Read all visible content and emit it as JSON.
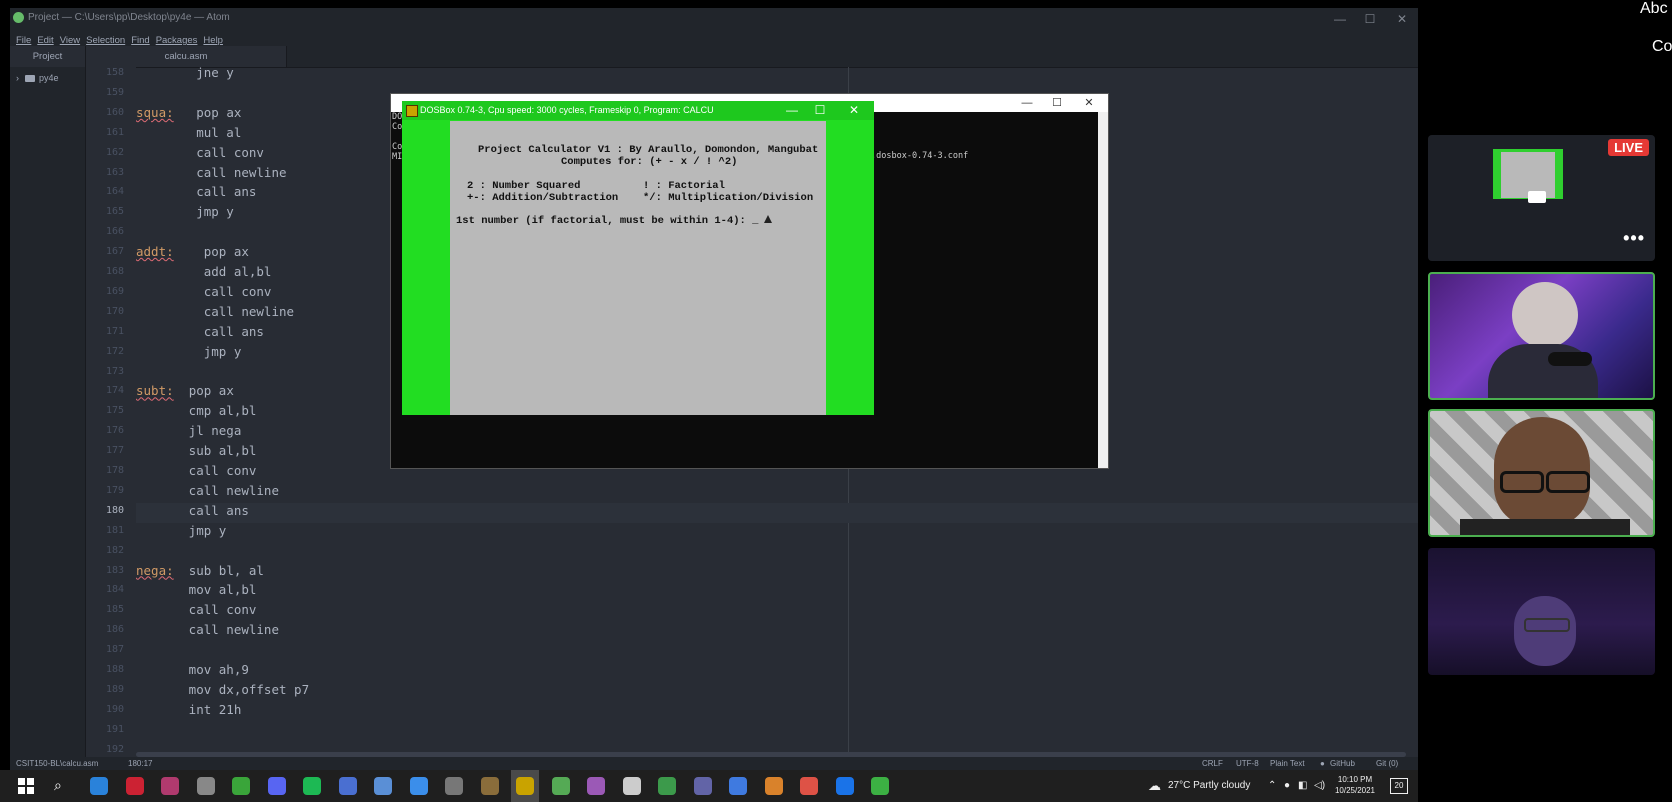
{
  "atom": {
    "title": "Project — C:\\Users\\pp\\Desktop\\py4e — Atom",
    "menu": [
      "File",
      "Edit",
      "View",
      "Selection",
      "Find",
      "Packages",
      "Help"
    ],
    "tabs": {
      "project": "Project",
      "file": "calcu.asm"
    },
    "tree_root": "py4e",
    "code_lines": [
      {
        "n": "158",
        "label": "",
        "text": "jne y",
        "indent": 8
      },
      {
        "n": "159",
        "label": "",
        "text": "",
        "indent": 0
      },
      {
        "n": "160",
        "label": "squa:",
        "text": "pop ax",
        "indent": 8
      },
      {
        "n": "161",
        "label": "",
        "text": "mul al",
        "indent": 8
      },
      {
        "n": "162",
        "label": "",
        "text": "call conv",
        "indent": 8
      },
      {
        "n": "163",
        "label": "",
        "text": "call newline",
        "indent": 8
      },
      {
        "n": "164",
        "label": "",
        "text": "call ans",
        "indent": 8
      },
      {
        "n": "165",
        "label": "",
        "text": "jmp y",
        "indent": 8
      },
      {
        "n": "166",
        "label": "",
        "text": "",
        "indent": 0
      },
      {
        "n": "167",
        "label": "addt:",
        "text": "pop ax",
        "indent": 9
      },
      {
        "n": "168",
        "label": "",
        "text": "add al,bl",
        "indent": 9
      },
      {
        "n": "169",
        "label": "",
        "text": "call conv",
        "indent": 9
      },
      {
        "n": "170",
        "label": "",
        "text": "call newline",
        "indent": 9
      },
      {
        "n": "171",
        "label": "",
        "text": "call ans",
        "indent": 9
      },
      {
        "n": "172",
        "label": "",
        "text": "jmp y",
        "indent": 9
      },
      {
        "n": "173",
        "label": "",
        "text": "",
        "indent": 0
      },
      {
        "n": "174",
        "label": "subt:",
        "text": "pop ax",
        "indent": 7
      },
      {
        "n": "175",
        "label": "",
        "text": "cmp al,bl",
        "indent": 7
      },
      {
        "n": "176",
        "label": "",
        "text": "jl nega",
        "indent": 7
      },
      {
        "n": "177",
        "label": "",
        "text": "sub al,bl",
        "indent": 7
      },
      {
        "n": "178",
        "label": "",
        "text": "call conv",
        "indent": 7
      },
      {
        "n": "179",
        "label": "",
        "text": "call newline",
        "indent": 7
      },
      {
        "n": "180",
        "label": "",
        "text": "call ans",
        "indent": 7
      },
      {
        "n": "181",
        "label": "",
        "text": "jmp y",
        "indent": 7
      },
      {
        "n": "182",
        "label": "",
        "text": "",
        "indent": 0
      },
      {
        "n": "183",
        "label": "nega:",
        "text": "sub bl, al",
        "indent": 7
      },
      {
        "n": "184",
        "label": "",
        "text": "mov al,bl",
        "indent": 7
      },
      {
        "n": "185",
        "label": "",
        "text": "call conv",
        "indent": 7
      },
      {
        "n": "186",
        "label": "",
        "text": "call newline",
        "indent": 7
      },
      {
        "n": "187",
        "label": "",
        "text": "",
        "indent": 0
      },
      {
        "n": "188",
        "label": "",
        "text": "mov ah,9",
        "indent": 7
      },
      {
        "n": "189",
        "label": "",
        "text": "mov dx,offset p7",
        "indent": 7
      },
      {
        "n": "190",
        "label": "",
        "text": "int 21h",
        "indent": 7
      },
      {
        "n": "191",
        "label": "",
        "text": "",
        "indent": 0
      },
      {
        "n": "192",
        "label": "",
        "text": "",
        "indent": 0
      }
    ],
    "cursor_line": "180",
    "status": {
      "path": "CSIT150-BL\\calcu.asm",
      "position": "180:17",
      "line_ending": "CRLF",
      "encoding": "UTF-8",
      "grammar": "Plain Text",
      "github": "GitHub",
      "git": "Git (0)"
    }
  },
  "terminal": {
    "lines": [
      "DO",
      "Co",
      "",
      "Co",
      "MI"
    ],
    "config": ".dosbox-0.74-3.conf"
  },
  "dosbox": {
    "title": "DOSBox 0.74-3, Cpu speed:    3000 cycles, Frameskip  0, Program:   CALCU",
    "screen": [
      "Project Calculator V1 : By Araullo, Domondon, Mangubat",
      "Computes for: (+ - x / ! ^2)",
      "2 : Number Squared",
      "! : Factorial",
      "+-: Addition/Subtraction",
      "*/: Multiplication/Division",
      "1st number (if factorial, must be within 1-4): _"
    ]
  },
  "taskbar": {
    "weather": "27°C  Partly cloudy",
    "time": "10:10 PM",
    "date": "10/25/2021",
    "notifications": "20",
    "icon_colors": [
      "#2a82da",
      "#cc2233",
      "#b03a6e",
      "#888",
      "#3aa53a",
      "#5865f2",
      "#1db954",
      "#4a6fd1",
      "#5a8fd6",
      "#3b8eea",
      "#777",
      "#8a6d3b",
      "#c9a300",
      "#55aa55",
      "#9b59b6",
      "#ccc",
      "#3c9a4b",
      "#6264a7",
      "#3f7ae0",
      "#d9822b",
      "#de5246",
      "#1a73e8",
      "#3cb043"
    ]
  },
  "meeting": {
    "top_right": "Abc",
    "top_right_2": "Co",
    "live_badge": "LIVE",
    "more": "•••"
  }
}
